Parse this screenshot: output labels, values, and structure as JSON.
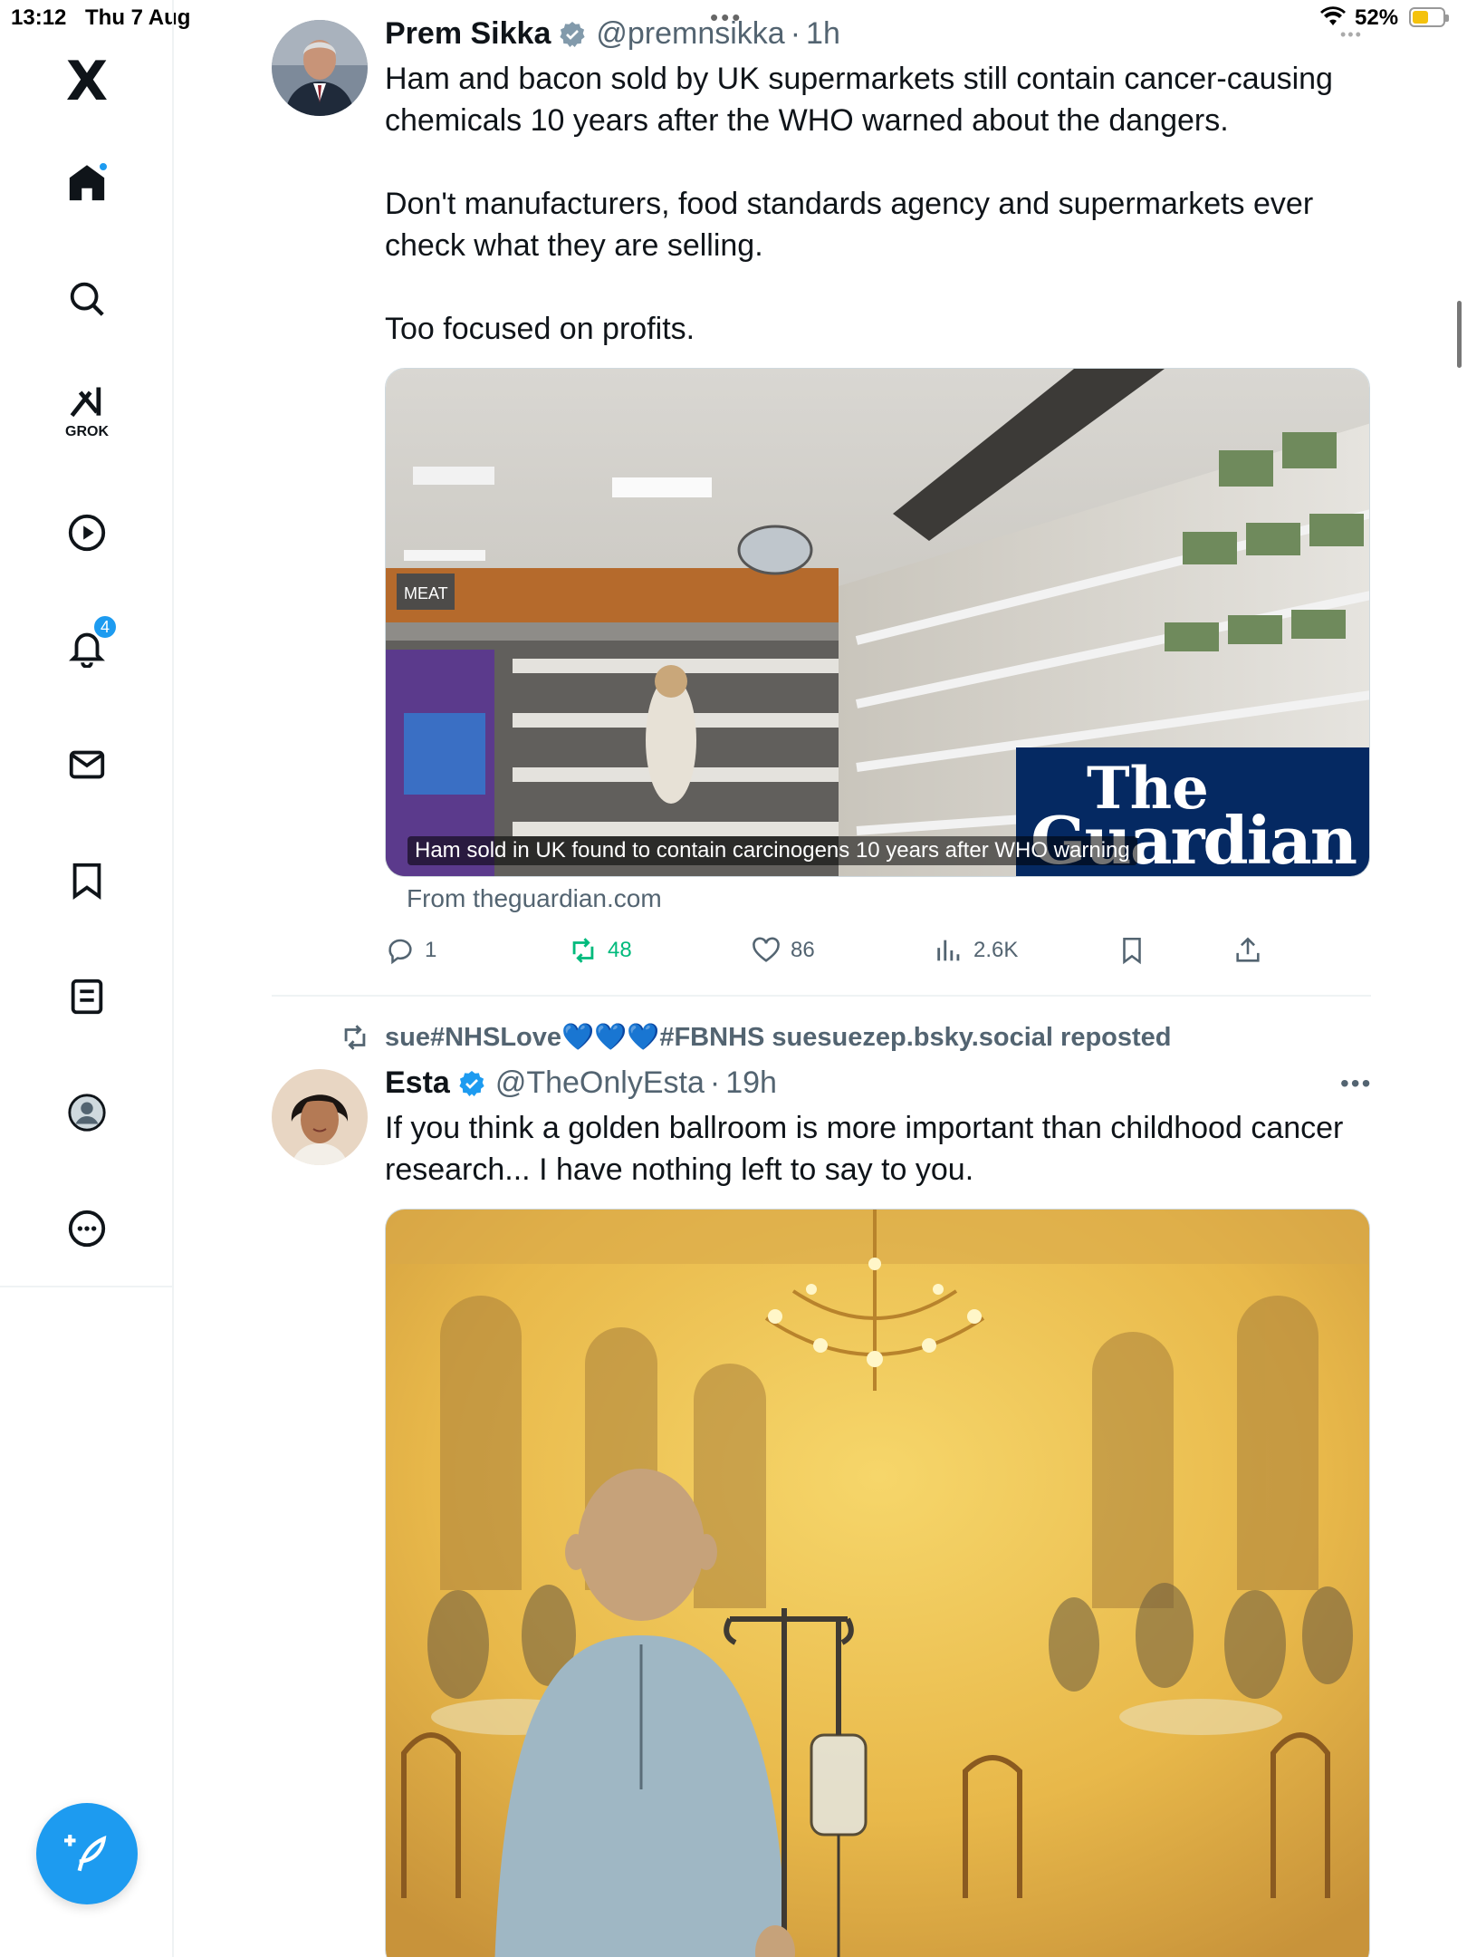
{
  "status_bar": {
    "time": "13:12",
    "date": "Thu 7 Aug",
    "battery_percent": "52%",
    "battery_level": 0.52
  },
  "sidebar": {
    "logo": "X",
    "items": [
      {
        "icon": "home-icon",
        "has_dot": true
      },
      {
        "icon": "search-icon"
      },
      {
        "icon": "grok-icon",
        "label": "GROK"
      },
      {
        "icon": "video-icon"
      },
      {
        "icon": "bell-icon",
        "badge": "4"
      },
      {
        "icon": "mail-icon"
      },
      {
        "icon": "bookmark-icon"
      },
      {
        "icon": "lists-icon"
      },
      {
        "icon": "profile-icon"
      },
      {
        "icon": "more-icon"
      }
    ],
    "compose_icon": "compose-icon"
  },
  "tweets": [
    {
      "name": "Prem Sikka",
      "handle": "@premnsikka",
      "time": "1h",
      "text": "Ham and bacon sold by UK supermarkets still contain cancer-causing chemicals 10 years after the WHO warned about the dangers.\n\nDon't manufacturers, food standards agency and supermarkets ever check what they are selling.\n\nToo focused on profits.",
      "card": {
        "caption": "Ham sold in UK found to contain carcinogens 10 years after WHO warning",
        "source": "From theguardian.com",
        "brand_the": "The",
        "brand_name": "Guardian",
        "shelf_sign": "MEAT"
      },
      "stats": {
        "replies": "1",
        "reposts": "48",
        "likes": "86",
        "views": "2.6K"
      }
    },
    {
      "reposted_by": "sue#NHSLove💙💙💙#FBNHS suesuezep.bsky.social reposted",
      "name": "Esta",
      "handle": "@TheOnlyEsta",
      "time": "19h",
      "text": "If you think a golden ballroom is more important than childhood cancer research... I have nothing left to say to you."
    }
  ],
  "colors": {
    "accent": "#1d9bf0",
    "retweet_green": "#00ba7c",
    "text_primary": "#0f1419",
    "text_secondary": "#536471",
    "guardian_blue": "#052962"
  }
}
